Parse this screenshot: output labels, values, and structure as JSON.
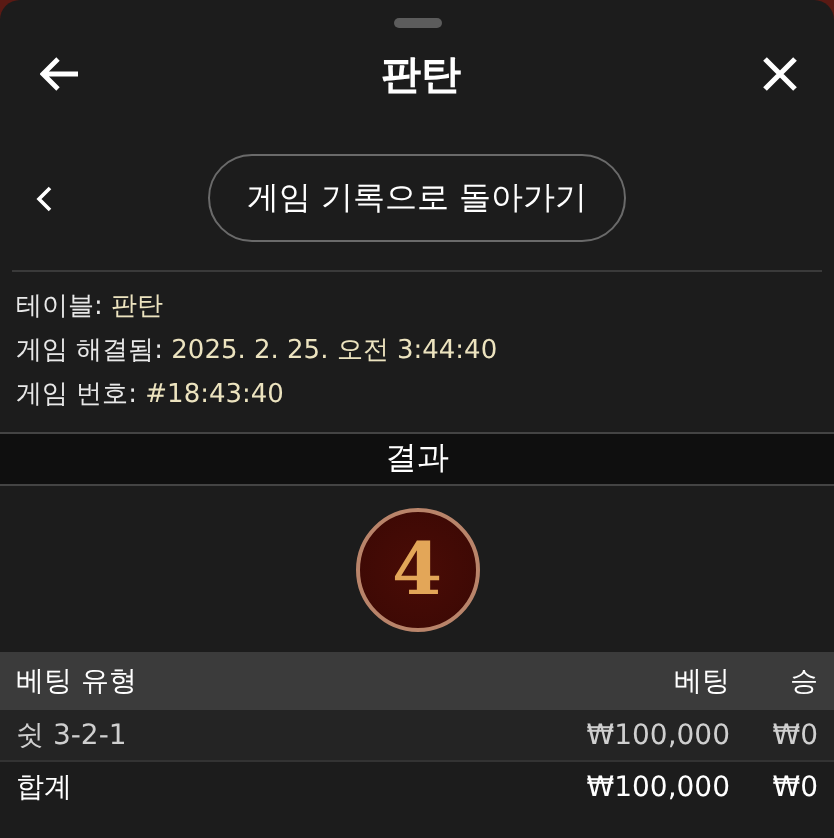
{
  "header": {
    "title": "판탄"
  },
  "back_link": {
    "label": "게임 기록으로 돌아가기"
  },
  "info": [
    {
      "label": "테이블:",
      "value": "판탄"
    },
    {
      "label": "게임 해결됨:",
      "value": "2025. 2. 25. 오전 3:44:40"
    },
    {
      "label": "게임 번호:",
      "value": "#18:43:40"
    }
  ],
  "result": {
    "title": "결과",
    "number": "4"
  },
  "table": {
    "columns": [
      "베팅 유형",
      "베팅",
      "승"
    ],
    "rows": [
      {
        "kind": "bet",
        "cells": [
          "쉿 3-2-1",
          "₩100,000",
          "₩0"
        ]
      },
      {
        "kind": "total",
        "cells": [
          "합계",
          "₩100,000",
          "₩0"
        ]
      }
    ]
  }
}
